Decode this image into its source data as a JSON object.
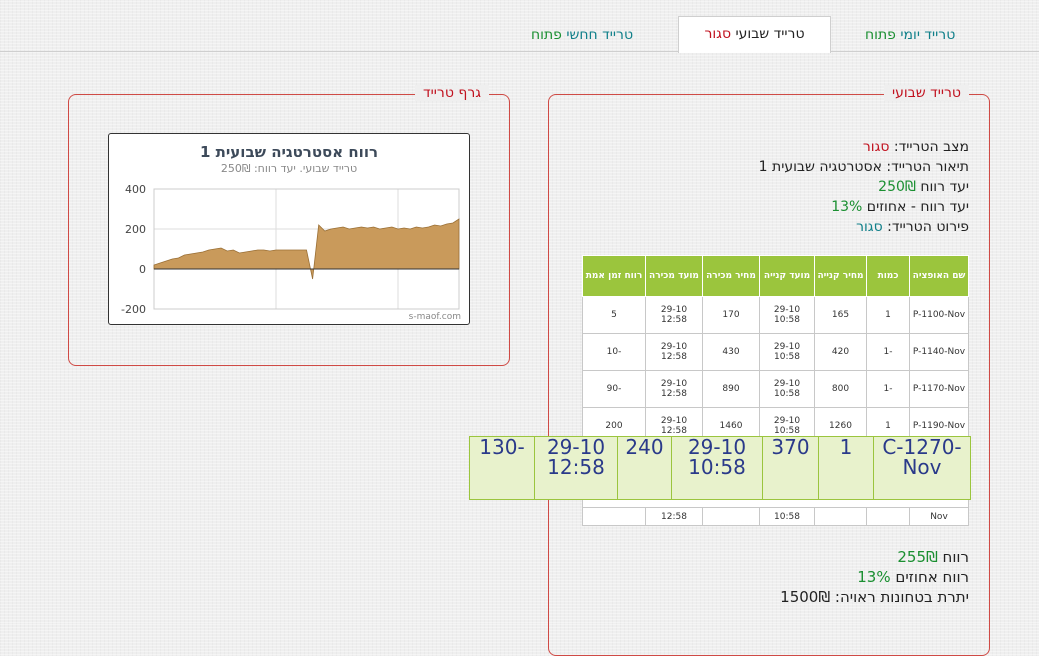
{
  "tabs": {
    "daily": {
      "prefix": "טרייד יומי",
      "status": "פתוח"
    },
    "weekly": {
      "prefix": "טרייד שבועי",
      "status": "סגור"
    },
    "monthly": {
      "prefix": "טרייד חחשי",
      "status": "פתוח"
    }
  },
  "weekly_panel": {
    "legend": "טרייד שבועי",
    "status_label": "מצב הטרייד:",
    "status_value": "סגור",
    "desc_label": "תיאור הטרייד:",
    "desc_value": "אסטרטגיה שבועית 1",
    "target_label": "יעד רווח",
    "target_value": "250₪",
    "target_pct_label": "יעד רווח - אחוזים",
    "target_pct_value": "13%",
    "detail_label": "פירוט הטרייד:",
    "detail_value": "סגור"
  },
  "table": {
    "headers": [
      "שם האופציה",
      "כמות",
      "מחיר קנייה",
      "מועד קנייה",
      "מחיר מכירה",
      "מועד מכירה",
      "רווח זמן אמת"
    ],
    "rows": [
      [
        "P-1100-Nov",
        "1",
        "165",
        "29-10 10:58",
        "170",
        "29-10 12:58",
        "5"
      ],
      [
        "P-1140-Nov",
        "-1",
        "420",
        "29-10 10:58",
        "430",
        "29-10 12:58",
        "-10"
      ],
      [
        "P-1170-Nov",
        "-1",
        "800",
        "29-10 10:58",
        "890",
        "29-10 12:58",
        "-90"
      ],
      [
        "P-1190-Nov",
        "1",
        "1260",
        "29-10 10:58",
        "1460",
        "29-10 12:58",
        "200"
      ]
    ],
    "last_row": [
      "Nov",
      "",
      "",
      "10:58",
      "",
      "12:58",
      ""
    ]
  },
  "popup_row": [
    "C-1270-Nov",
    "1",
    "370",
    "29-10 10:58",
    "240",
    "29-10 12:58",
    "-130"
  ],
  "summary": {
    "profit_label": "רווח",
    "profit_value": "255₪",
    "pct_label": "רווח אחוזים",
    "pct_value": "13%",
    "margin_label": "יתרת בטחונות ראויה:",
    "margin_value": "1500₪"
  },
  "graph_panel": {
    "legend": "גרף טרייד",
    "credit": "s-maof.com"
  },
  "chart_data": {
    "type": "area",
    "title": "רווח אסטרטגיה שבועית 1",
    "subtitle": "טרייד שבועי. יעד רווח: 250₪",
    "y_ticks": [
      "400",
      "200",
      "0",
      "-200"
    ],
    "ylim": [
      -200,
      400
    ],
    "grid": true,
    "x": [
      0,
      2,
      4,
      6,
      8,
      10,
      12,
      14,
      16,
      18,
      20,
      22,
      24,
      26,
      28,
      30,
      32,
      34,
      36,
      38,
      40,
      42,
      44,
      46,
      48,
      50,
      52,
      54,
      56,
      58,
      60,
      62,
      64,
      66,
      68,
      70,
      72,
      74,
      76,
      78,
      80,
      82,
      84,
      86,
      88,
      90,
      92,
      94,
      96,
      98,
      100
    ],
    "values": [
      20,
      30,
      40,
      50,
      55,
      70,
      75,
      80,
      85,
      95,
      100,
      105,
      90,
      95,
      80,
      85,
      90,
      95,
      95,
      90,
      95,
      95,
      95,
      95,
      95,
      95,
      -50,
      220,
      190,
      200,
      205,
      210,
      200,
      205,
      210,
      205,
      210,
      200,
      205,
      210,
      200,
      205,
      200,
      210,
      205,
      210,
      220,
      215,
      225,
      230,
      250
    ]
  }
}
